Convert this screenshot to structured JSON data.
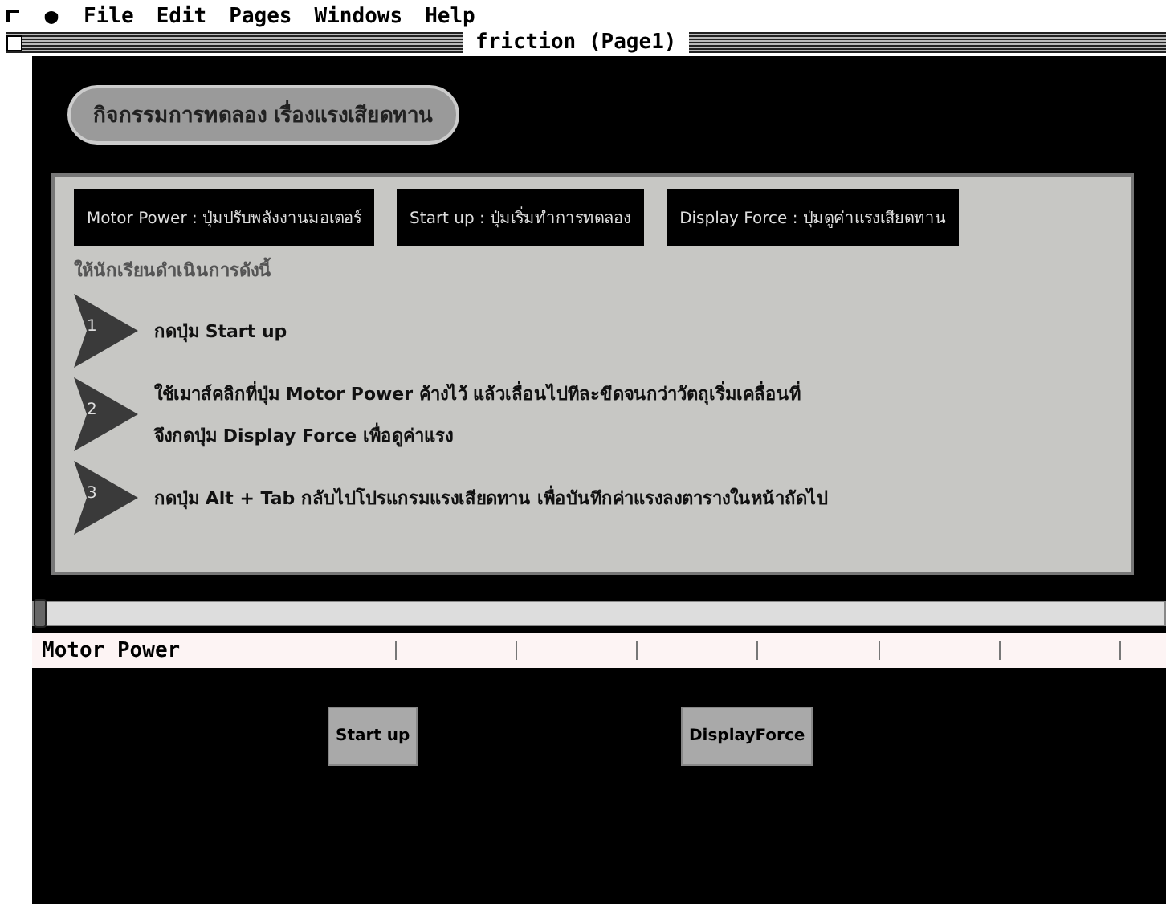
{
  "menu_bar": [
    "File",
    "Edit",
    "Pages",
    "Windows",
    "Help"
  ],
  "window": {
    "title": "friction (Page1)"
  },
  "banner": "กิจกรรมการทดลอง เรื่องแรงเสียดทาน",
  "legend": [
    "Motor Power : ปุ่มปรับพลังงานมอเตอร์",
    "Start up : ปุ่มเริ่มทำการทดลอง",
    "Display Force : ปุ่มดูค่าแรงเสียดทาน"
  ],
  "instruction": "ให้นักเรียนดำเนินการดังนี้",
  "steps": [
    {
      "number": "1",
      "lines": [
        "กดปุ่ม Start up"
      ]
    },
    {
      "number": "2",
      "lines": [
        "ใช้เมาส์คลิกที่ปุ่ม Motor Power ค้างไว้ แล้วเลื่อนไปทีละขีดจนกว่าวัตถุเริ่มเคลื่อนที่",
        "จึงกดปุ่ม Display Force เพื่อดูค่าแรง"
      ]
    },
    {
      "number": "3",
      "lines": [
        "กดปุ่ม Alt + Tab กลับไปโปรแกรมแรงเสียดทาน เพื่อบันทึกค่าแรงลงตารางในหน้าถัดไป"
      ]
    }
  ],
  "slider": {
    "label": "Motor Power",
    "level": 0
  },
  "buttons": [
    "Start up",
    "DisplayForce"
  ]
}
